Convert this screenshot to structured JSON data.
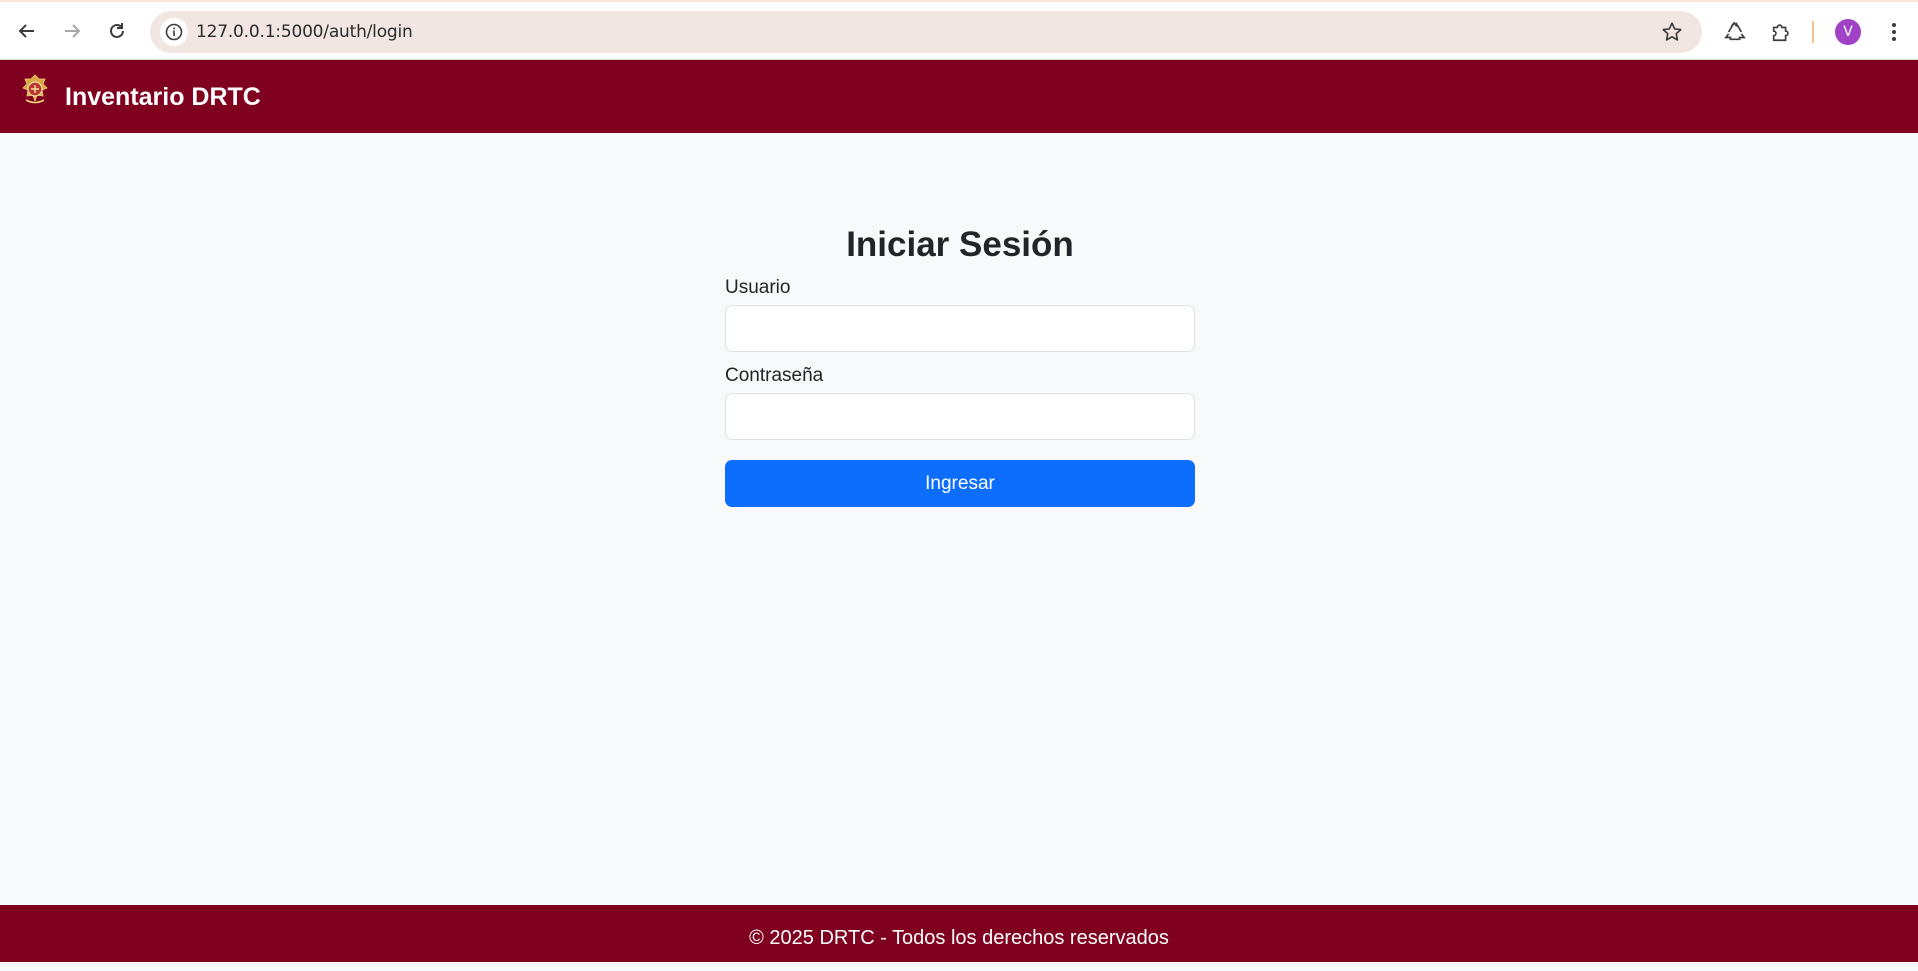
{
  "browser": {
    "url": "127.0.0.1:5000/auth/login",
    "profile_initial": "V",
    "icons": {
      "back": "arrow-left-icon",
      "forward": "arrow-right-icon",
      "reload": "reload-icon",
      "site_info": "info-icon",
      "bookmark": "star-icon",
      "recycle": "recycle-icon",
      "extensions": "puzzle-icon",
      "menu": "kebab-menu-icon"
    }
  },
  "navbar": {
    "brand": "Inventario DRTC",
    "logo_icon": "crest-logo-icon"
  },
  "login": {
    "title": "Iniciar Sesión",
    "username_label": "Usuario",
    "username_value": "",
    "password_label": "Contraseña",
    "password_value": "",
    "submit_label": "Ingresar"
  },
  "footer": {
    "text": "© 2025 DRTC - Todos los derechos reservados"
  },
  "colors": {
    "brand": "#800020",
    "primary_button": "#0d6efd",
    "page_bg": "#f8f9fa"
  }
}
